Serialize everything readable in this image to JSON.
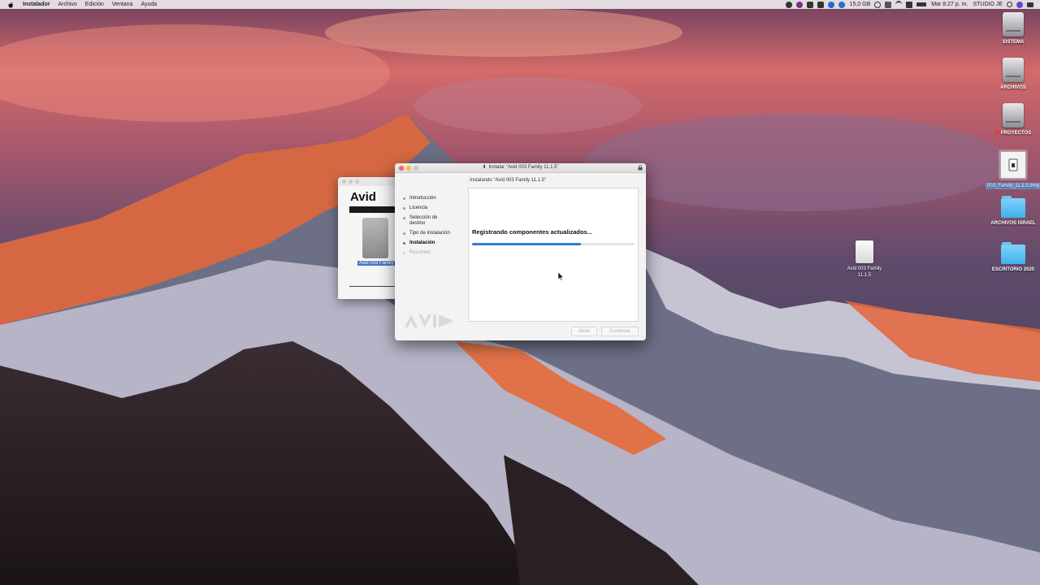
{
  "menubar": {
    "app_name": "Instalador",
    "menus": [
      "Archivo",
      "Edición",
      "Ventana",
      "Ayuda"
    ],
    "status_items": [
      "15,0 GB",
      "Mar 8:27 p. m.",
      "STUDIO JE"
    ]
  },
  "desktop_icons": [
    {
      "label": "SISTEMA",
      "kind": "drive"
    },
    {
      "label": "ARCHIVOS",
      "kind": "drive"
    },
    {
      "label": "PROYECTOS",
      "kind": "drive",
      "tag_color": "#e33333"
    },
    {
      "label": "003_Family_11.1.5.dmg",
      "kind": "dmg",
      "selected": true
    },
    {
      "label": "ARCHIVOS ISRAEL",
      "kind": "folder"
    },
    {
      "label": "ESCRITORIO 2020",
      "kind": "folder"
    },
    {
      "label": "Avid 003 Family 11.1.5",
      "kind": "package"
    }
  ],
  "background_window": {
    "logo": "Avid",
    "strip_text": "003 Family",
    "caption": "Avid 003 Family"
  },
  "installer": {
    "title": "Instalar \"Avid 003 Family 11.1.5\"",
    "subtitle": "Instalando \"Avid 003 Family 11.1.5\"",
    "steps": [
      {
        "label": "Introducción",
        "state": "done"
      },
      {
        "label": "Licencia",
        "state": "done"
      },
      {
        "label": "Selección de destino",
        "state": "done"
      },
      {
        "label": "Tipo de instalación",
        "state": "done"
      },
      {
        "label": "Instalación",
        "state": "active"
      },
      {
        "label": "Resumen",
        "state": "pending"
      }
    ],
    "status": "Registrando componentes actualizados...",
    "progress_percent": 67,
    "back_button": "Atrás",
    "continue_button": "Continuar",
    "accent_color": "#2f7bd6"
  }
}
